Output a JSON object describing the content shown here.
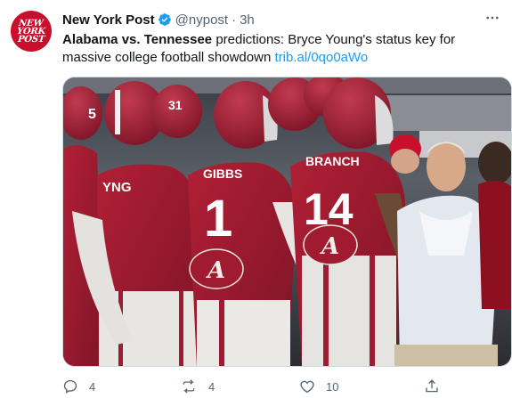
{
  "tweet": {
    "avatar_text": [
      "NEW",
      "YORK",
      "POST"
    ],
    "name": "New York Post",
    "handle": "@nypost",
    "separator": "·",
    "time": "3h",
    "text_bold": "Alabama vs. Tennessee",
    "text_rest": " predictions: Bryce Young's status key for massive college football showdown ",
    "link": "trib.al/0qo0aWo",
    "media": {
      "jersey_left_partial": "5",
      "jersey_31": "31",
      "name_left": "YNG",
      "name_gibbs": "GIBBS",
      "number_gibbs": "1",
      "name_branch": "BRANCH",
      "number_branch": "14",
      "logo_letter": "A"
    },
    "actions": {
      "reply_count": "4",
      "retweet_count": "4",
      "like_count": "10"
    }
  },
  "colors": {
    "brand_red": "#c8102e",
    "link_blue": "#1d9bf0",
    "muted": "#536471",
    "crimson": "#9e1b32"
  },
  "icons": {
    "verified": "verified-badge-icon",
    "more": "more-dots-icon",
    "reply": "reply-icon",
    "retweet": "retweet-icon",
    "like": "heart-icon",
    "share": "share-icon"
  }
}
